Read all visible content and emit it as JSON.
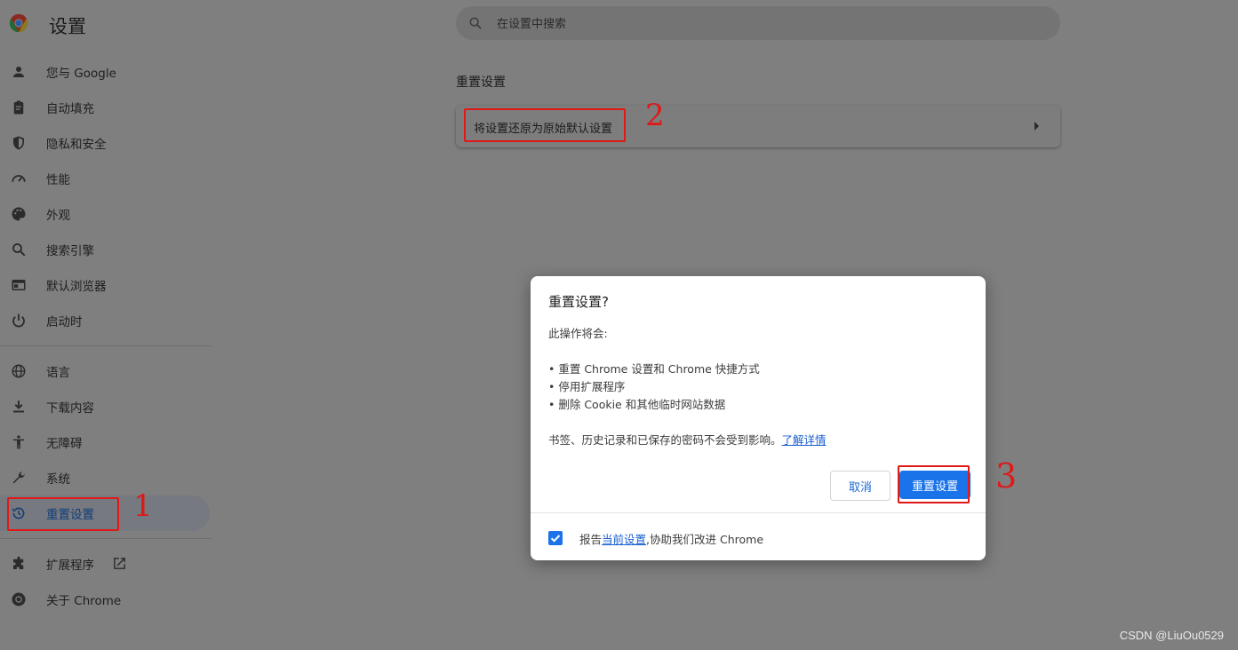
{
  "header": {
    "title": "设置"
  },
  "search": {
    "placeholder": "在设置中搜索"
  },
  "sidebar": {
    "items": [
      {
        "label": "您与 Google",
        "icon": "person-icon"
      },
      {
        "label": "自动填充",
        "icon": "clipboard-icon"
      },
      {
        "label": "隐私和安全",
        "icon": "shield-icon"
      },
      {
        "label": "性能",
        "icon": "speedometer-icon"
      },
      {
        "label": "外观",
        "icon": "palette-icon"
      },
      {
        "label": "搜索引擎",
        "icon": "search-icon"
      },
      {
        "label": "默认浏览器",
        "icon": "browser-window-icon"
      },
      {
        "label": "启动时",
        "icon": "power-icon"
      },
      {
        "label": "语言",
        "icon": "globe-icon"
      },
      {
        "label": "下载内容",
        "icon": "download-icon"
      },
      {
        "label": "无障碍",
        "icon": "accessibility-icon"
      },
      {
        "label": "系统",
        "icon": "wrench-icon"
      },
      {
        "label": "重置设置",
        "icon": "history-icon",
        "active": true
      },
      {
        "label": "扩展程序",
        "icon": "puzzle-icon"
      },
      {
        "label": "关于 Chrome",
        "icon": "chrome-icon"
      }
    ]
  },
  "main": {
    "section_title": "重置设置",
    "reset_row_label": "将设置还原为原始默认设置"
  },
  "dialog": {
    "title": "重置设置?",
    "intro": "此操作将会:",
    "bullets": [
      "• 重置 Chrome 设置和 Chrome 快捷方式",
      "• 停用扩展程序",
      "• 删除 Cookie 和其他临时网站数据"
    ],
    "note": "书签、历史记录和已保存的密码不会受到影响。",
    "learn_more": "了解详情",
    "cancel_label": "取消",
    "reset_label": "重置设置",
    "footer_prefix": "报告",
    "footer_link": "当前设置",
    "footer_suffix": ",协助我们改进 Chrome",
    "report_checked": true
  },
  "annotations": {
    "one": "1",
    "two": "2",
    "three": "3"
  },
  "watermark": "CSDN @LiuOu0529",
  "colors": {
    "accent": "#1a73e8",
    "annotation": "#e01818"
  }
}
